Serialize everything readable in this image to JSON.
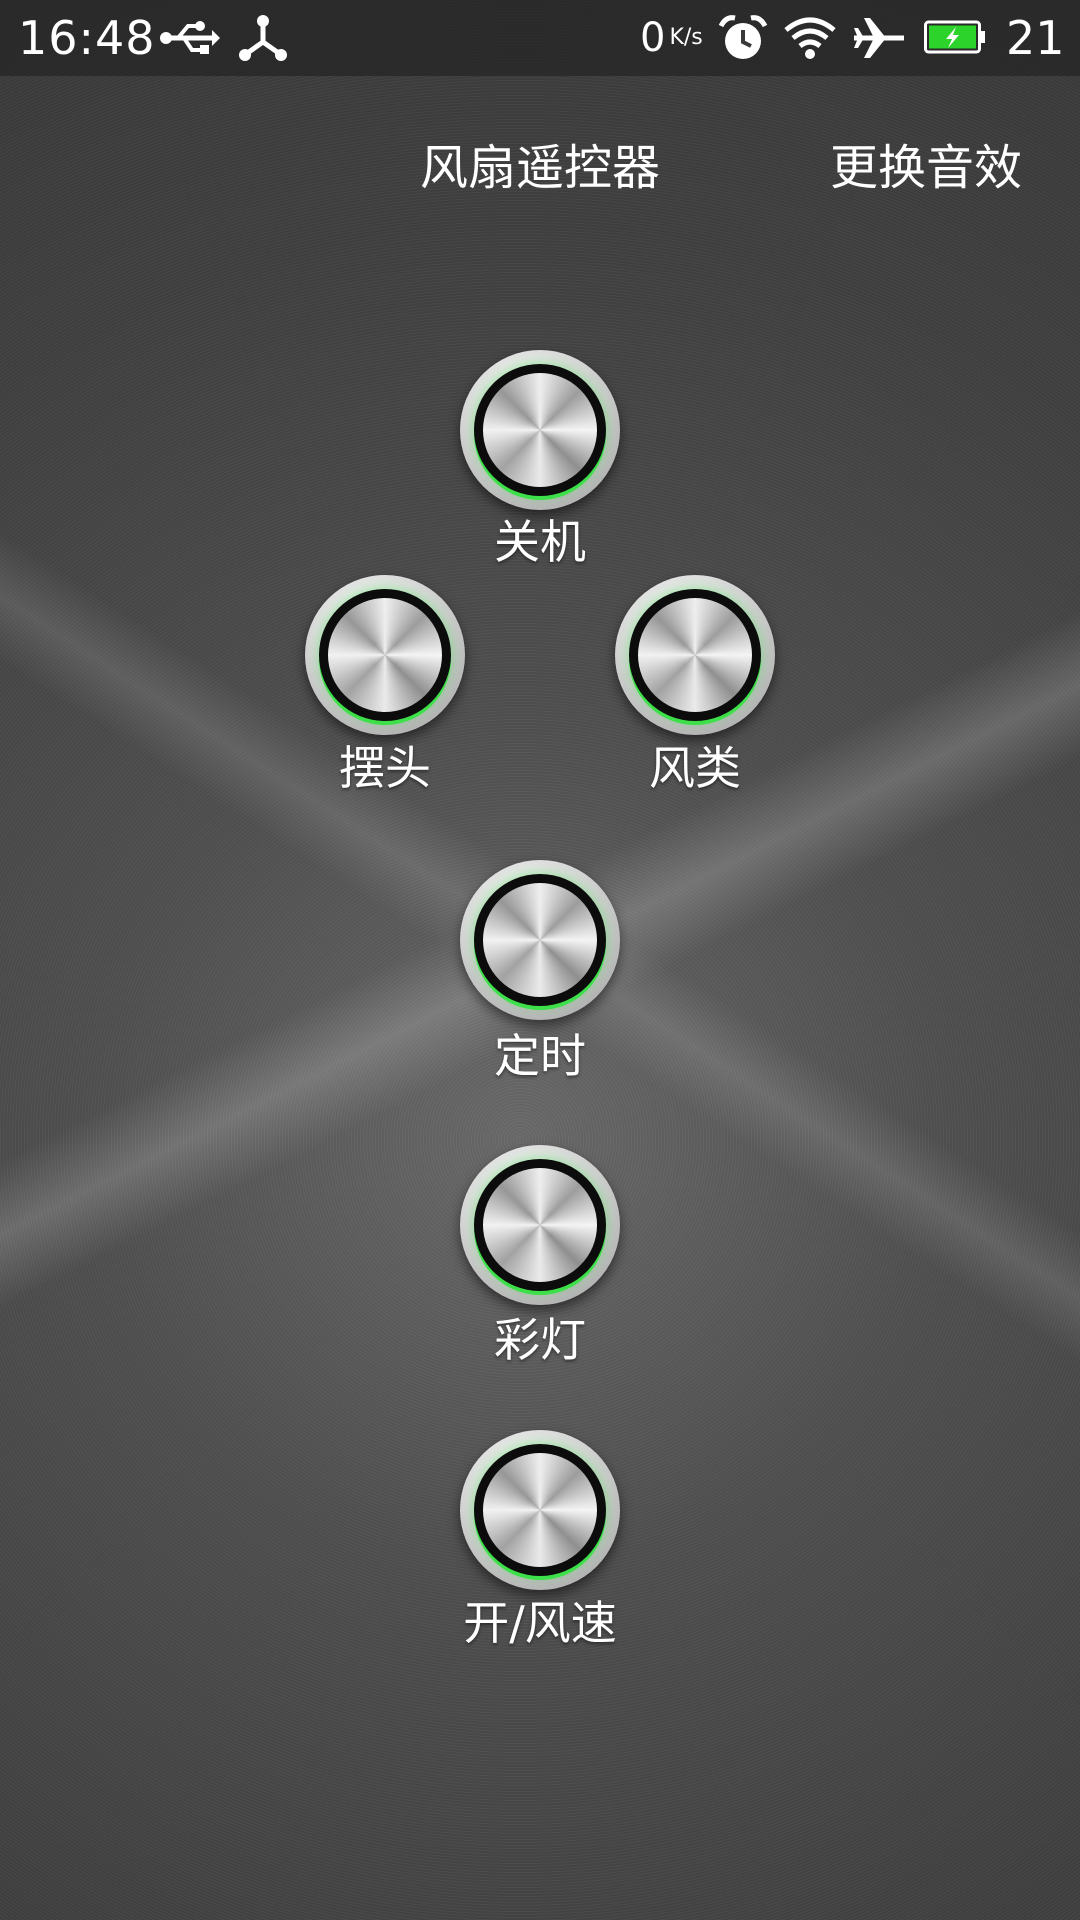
{
  "status_bar": {
    "time": "16:48",
    "net_speed_value": "0",
    "net_speed_unit": "K/s",
    "battery_level": "21",
    "icons": [
      "usb-icon",
      "share-icon",
      "alarm-icon",
      "wifi-icon",
      "airplane-icon",
      "battery-charging-icon"
    ],
    "battery_color": "#2bd32b"
  },
  "header": {
    "title": "风扇遥控器",
    "change_sound_label": "更换音效"
  },
  "buttons": {
    "power_off": "关机",
    "swing": "摆头",
    "wind_type": "风类",
    "timer": "定时",
    "light": "彩灯",
    "power_speed": "开/风速"
  },
  "colors": {
    "accent_ring": "#3ee04a"
  }
}
